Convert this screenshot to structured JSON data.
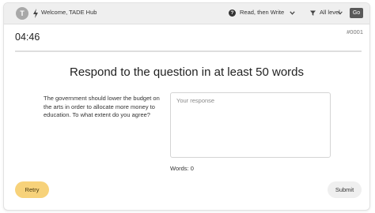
{
  "header": {
    "avatar_initial": "T",
    "welcome_text": "Welcome, TADE Hub",
    "mode_label": "Read, then Write",
    "level_label": "All level",
    "go_label": "Go"
  },
  "status": {
    "timer": "04:46",
    "question_id": "#0001"
  },
  "main": {
    "title": "Respond to the question in at least 50 words",
    "prompt": "The government should lower the budget on the arts in order to allocate more money to education. To what extent do you agree?",
    "response_placeholder": "Your response",
    "word_count": "Words: 0"
  },
  "actions": {
    "retry_label": "Retry",
    "submit_label": "Submit"
  },
  "colors": {
    "topbar_bg": "#efefef",
    "retry_bg": "#f7d27a",
    "submit_bg": "#efefef",
    "go_bg": "#5a5a5a"
  },
  "icons": {
    "bolt": "bolt-icon",
    "help": "help-icon",
    "mode_chevron": "chevron-down-icon",
    "level": "filter-icon",
    "level_chevron": "chevron-down-icon"
  }
}
